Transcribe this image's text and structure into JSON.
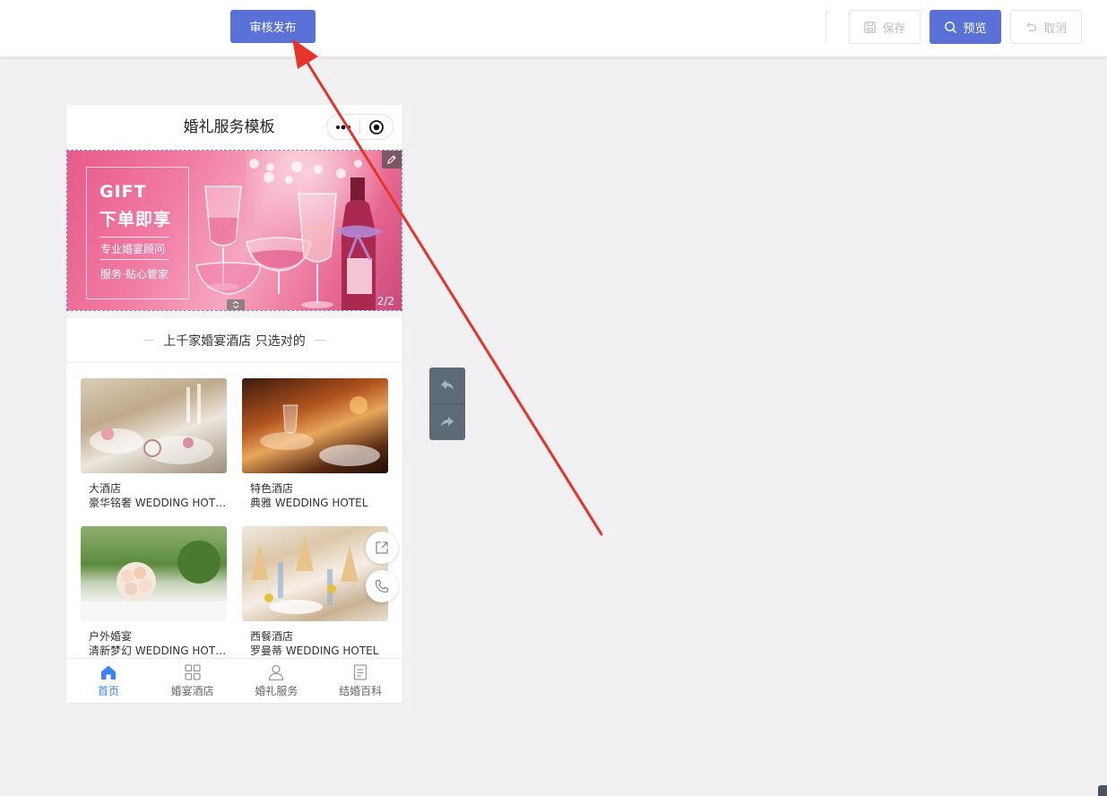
{
  "toolbar": {
    "publish_label": "审核发布",
    "save_label": "保存",
    "preview_label": "预览",
    "cancel_label": "取消"
  },
  "phone": {
    "title": "婚礼服务模板",
    "banner": {
      "heading_en": "GIFT",
      "heading_cn": "下单即享",
      "line1": "专业婚宴顾问",
      "line2": "服务·贴心管家",
      "counter": "2/2"
    },
    "section_title": "上千家婚宴酒店 只选对的",
    "hotels": [
      {
        "name": "大酒店",
        "desc": "豪华铭奢 WEDDING HOTEL"
      },
      {
        "name": "特色酒店",
        "desc": "典雅 WEDDING HOTEL"
      },
      {
        "name": "户外婚宴",
        "desc": "清新梦幻 WEDDING HOTEL"
      },
      {
        "name": "西餐酒店",
        "desc": "罗曼蒂 WEDDING HOTEL"
      }
    ],
    "tabs": [
      {
        "label": "首页",
        "icon": "home-icon",
        "active": true
      },
      {
        "label": "婚宴酒店",
        "icon": "grid-icon",
        "active": false
      },
      {
        "label": "婚礼服务",
        "icon": "user-icon",
        "active": false
      },
      {
        "label": "结婚百科",
        "icon": "document-icon",
        "active": false
      }
    ]
  },
  "colors": {
    "accent": "#5a72d8",
    "tab_active": "#3b82f6",
    "annotation": "#e8332a",
    "history_panel": "#5d6b78"
  }
}
